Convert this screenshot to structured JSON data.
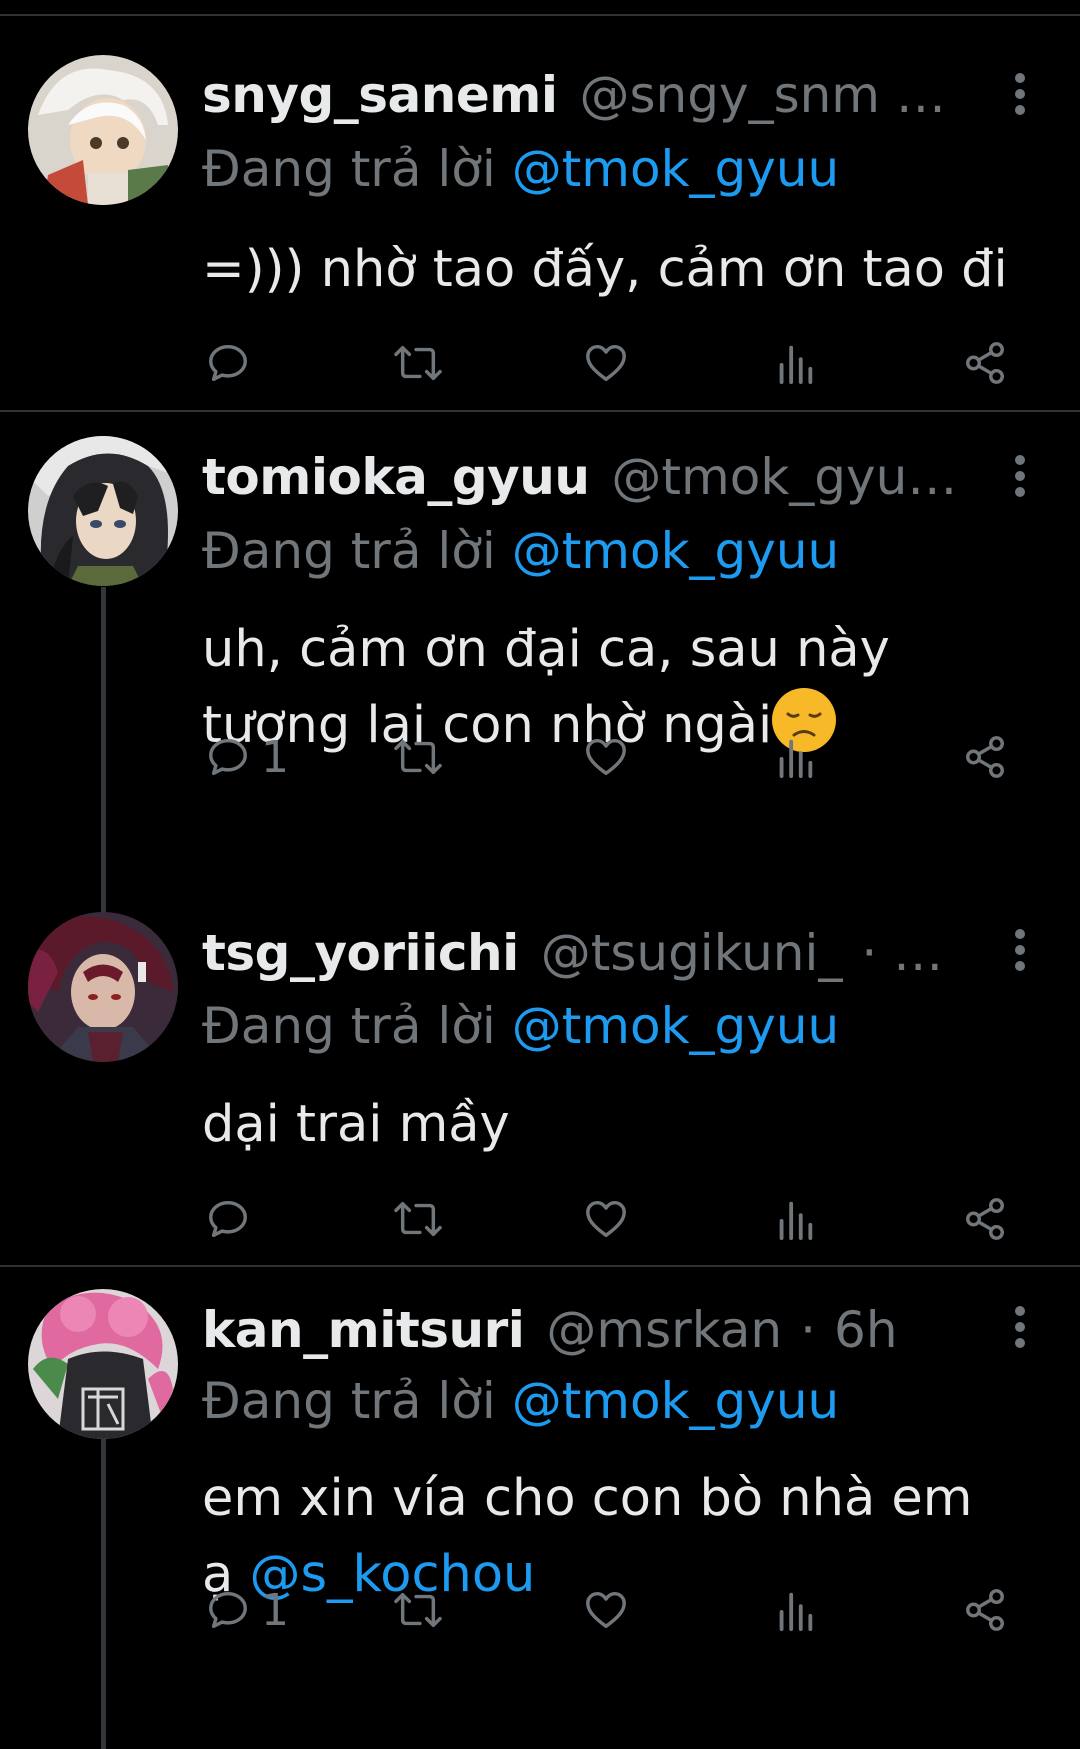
{
  "colors": {
    "background": "#000000",
    "text": "#e7e9ea",
    "muted": "#71767b",
    "accent": "#1d9bf0",
    "divider": "#2f3336"
  },
  "tweets": [
    {
      "name": "snyg_sanemi",
      "handle": "@sngy_snm …",
      "reply_prefix": "Đang trả lời",
      "reply_mention": "@tmok_gyuu",
      "body_lines": [
        "=))) nhờ tao đấy, cảm ơn tao đi"
      ],
      "reply_count": "",
      "avatar": "white-hair-avatar"
    },
    {
      "name": "tomioka_gyuu",
      "handle": "@tmok_gyu…",
      "reply_prefix": "Đang trả lời",
      "reply_mention": "@tmok_gyuu",
      "body_lines": [
        "uh, cảm ơn đại ca, sau này",
        "tương lai con nhờ ngài"
      ],
      "body_emoji": "disappointed-face-emoji",
      "reply_count": "1",
      "avatar": "dark-hair-avatar"
    },
    {
      "name": "tsg_yoriichi",
      "handle": "@tsugikuni_",
      "handle_suffix": "· …",
      "reply_prefix": "Đang trả lời",
      "reply_mention": "@tmok_gyuu",
      "body_lines": [
        "dại trai mầy"
      ],
      "reply_count": "",
      "avatar": "red-hair-avatar"
    },
    {
      "name": "kan_mitsuri",
      "handle": "@msrkan",
      "separator": "·",
      "time": "6h",
      "reply_prefix": "Đang trả lời",
      "reply_mention": "@tmok_gyuu",
      "body_line1": "em xin vía cho con bò nhà em",
      "body_line2_prefix": "ạ",
      "body_line2_mention": "@s_kochou",
      "reply_count": "1",
      "avatar": "pink-hair-avatar"
    }
  ]
}
